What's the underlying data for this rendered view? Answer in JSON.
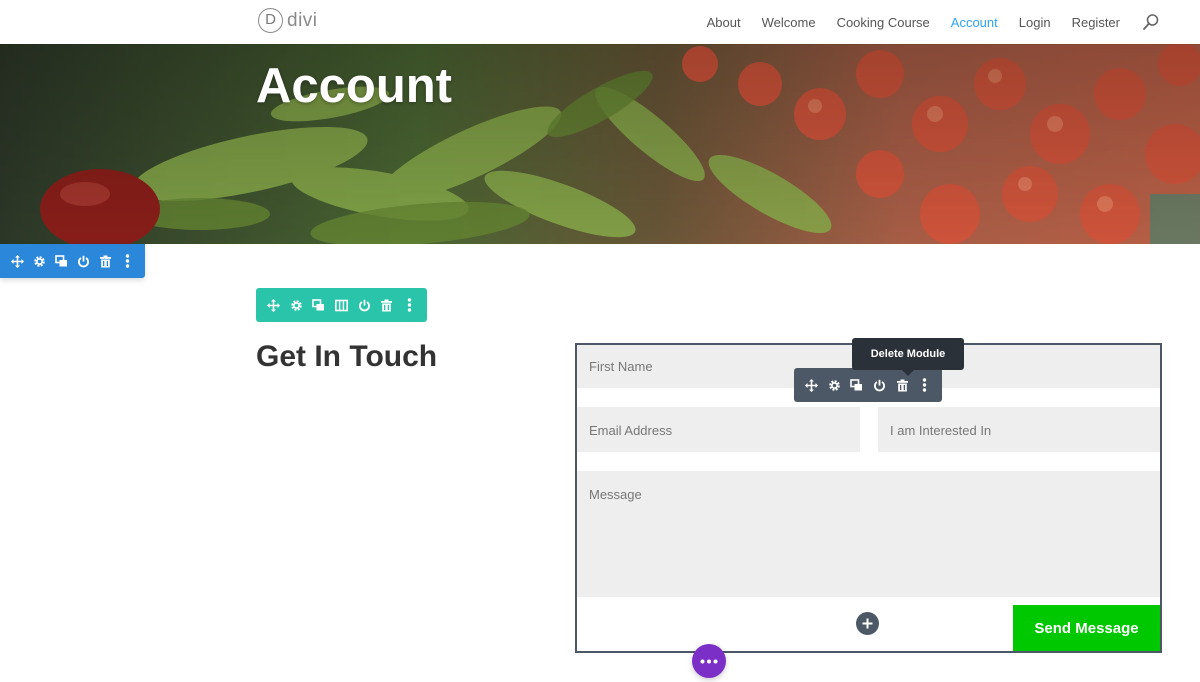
{
  "header": {
    "logo_mark": "D",
    "logo_text": "divi",
    "nav": [
      {
        "label": "About",
        "active": false
      },
      {
        "label": "Welcome",
        "active": false
      },
      {
        "label": "Cooking Course",
        "active": false
      },
      {
        "label": "Account",
        "active": true
      },
      {
        "label": "Login",
        "active": false
      },
      {
        "label": "Register",
        "active": false
      }
    ],
    "search_icon": "search-icon",
    "accent_color": "#2ea3f2"
  },
  "hero": {
    "title": "Account"
  },
  "section_toolbar": {
    "color": "#2b87da",
    "icons": [
      "move-icon",
      "gear-icon",
      "duplicate-icon",
      "power-icon",
      "trash-icon",
      "more-icon"
    ]
  },
  "row_toolbar": {
    "color": "#29c4a9",
    "icons": [
      "move-icon",
      "gear-icon",
      "duplicate-icon",
      "columns-icon",
      "power-icon",
      "trash-icon",
      "more-icon"
    ]
  },
  "module_toolbar": {
    "color": "#4c5866",
    "icons": [
      "move-icon",
      "gear-icon",
      "duplicate-icon",
      "power-icon",
      "trash-icon",
      "more-icon"
    ],
    "tooltip": "Delete Module"
  },
  "content": {
    "heading": "Get In Touch"
  },
  "form": {
    "first_name_placeholder": "First Name",
    "email_placeholder": "Email Address",
    "interest_placeholder": "I am Interested In",
    "message_placeholder": "Message",
    "submit_label": "Send Message",
    "submit_color": "#00c800"
  },
  "builder": {
    "add_icon": "plus-icon",
    "more_icon": "ellipsis-icon",
    "more_color": "#7b2fc6"
  }
}
